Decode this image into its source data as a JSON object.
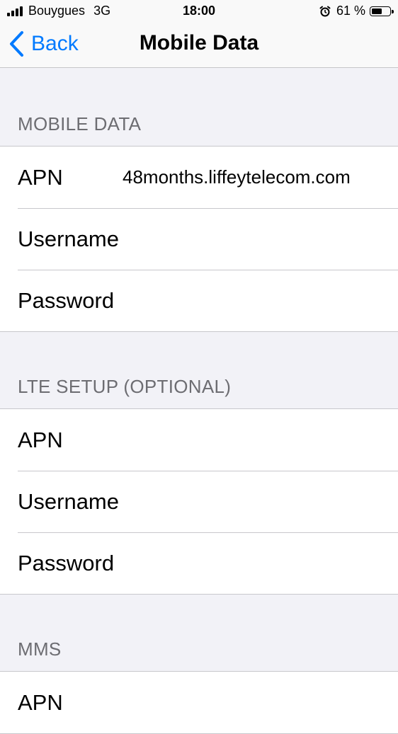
{
  "status_bar": {
    "carrier": "Bouygues",
    "network": "3G",
    "time": "18:00",
    "battery_percent": "61 %",
    "battery_level": 0.61,
    "icons": [
      "signal-icon",
      "alarm-icon",
      "battery-icon"
    ]
  },
  "nav": {
    "back_label": "Back",
    "title": "Mobile Data",
    "accent_color": "#007aff"
  },
  "sections": [
    {
      "header": "MOBILE DATA",
      "rows": [
        {
          "label": "APN",
          "value": "48months.liffeytelecom.com"
        },
        {
          "label": "Username",
          "value": ""
        },
        {
          "label": "Password",
          "value": ""
        }
      ]
    },
    {
      "header": "LTE SETUP (OPTIONAL)",
      "rows": [
        {
          "label": "APN",
          "value": ""
        },
        {
          "label": "Username",
          "value": ""
        },
        {
          "label": "Password",
          "value": ""
        }
      ]
    },
    {
      "header": "MMS",
      "rows": [
        {
          "label": "APN",
          "value": ""
        }
      ]
    }
  ]
}
